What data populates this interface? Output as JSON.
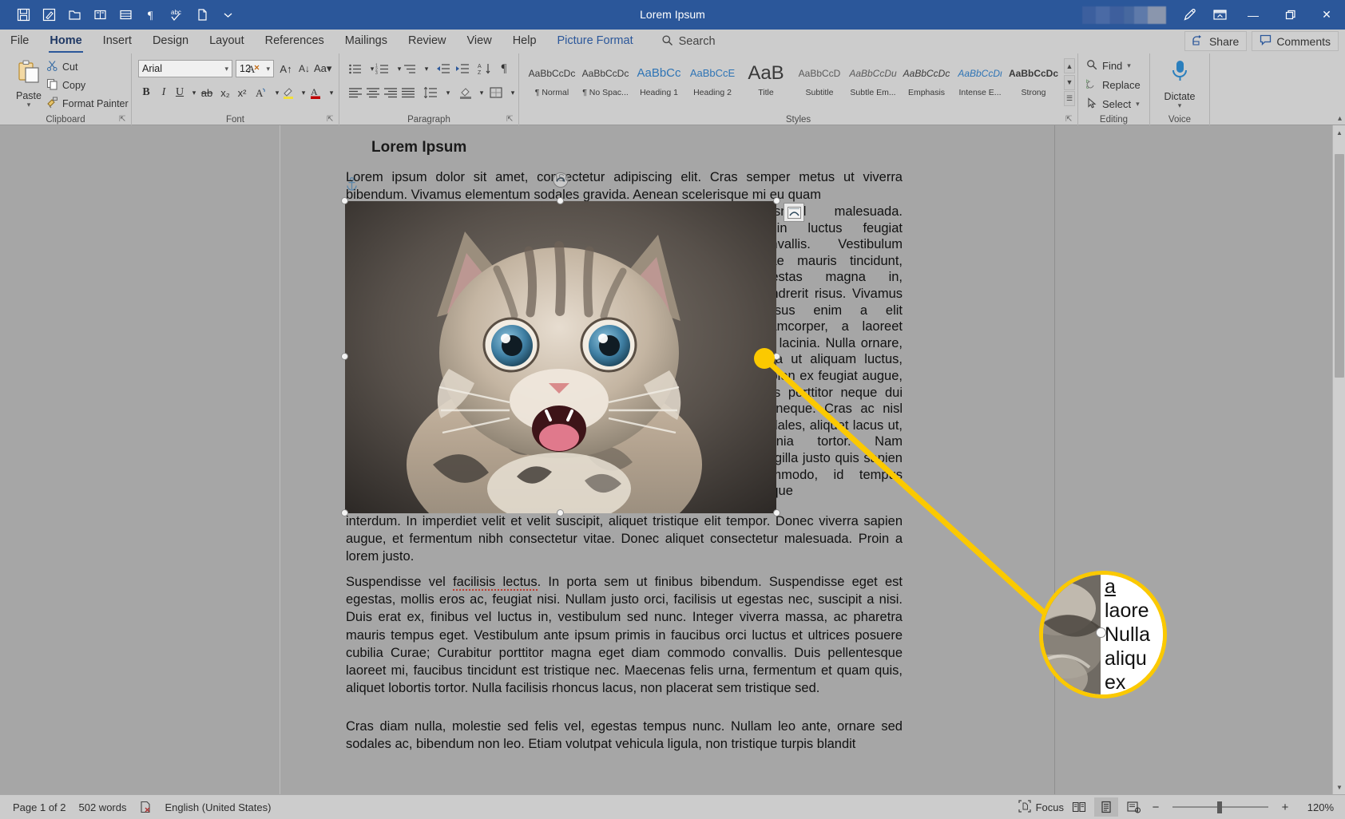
{
  "window": {
    "title": "Lorem Ipsum",
    "quick_access": [
      {
        "name": "save-icon",
        "label": "Save"
      },
      {
        "name": "autosave-icon",
        "label": "AutoSave"
      },
      {
        "name": "open-icon",
        "label": "Open"
      },
      {
        "name": "print-preview-icon",
        "label": "Print Preview and Print"
      },
      {
        "name": "table-icon",
        "label": "Draw Table"
      },
      {
        "name": "pilcrow-icon",
        "label": "Show/Hide Formatting Marks"
      },
      {
        "name": "spelling-icon",
        "label": "Spelling & Grammar"
      },
      {
        "name": "new-doc-icon",
        "label": "New"
      },
      {
        "name": "chevron-down-icon",
        "label": "Customize Quick Access Toolbar"
      }
    ],
    "right_icons": [
      {
        "name": "pen-icon",
        "label": "Draw"
      },
      {
        "name": "ribbon-display-icon",
        "label": "Ribbon Display Options"
      }
    ],
    "controls": {
      "minimize": "—",
      "restore": "❐",
      "close": "✕"
    }
  },
  "tabs": [
    {
      "label": "File",
      "active": false
    },
    {
      "label": "Home",
      "active": true
    },
    {
      "label": "Insert",
      "active": false
    },
    {
      "label": "Design",
      "active": false
    },
    {
      "label": "Layout",
      "active": false
    },
    {
      "label": "References",
      "active": false
    },
    {
      "label": "Mailings",
      "active": false
    },
    {
      "label": "Review",
      "active": false
    },
    {
      "label": "View",
      "active": false
    },
    {
      "label": "Help",
      "active": false
    },
    {
      "label": "Picture Format",
      "active": false,
      "contextual": true
    }
  ],
  "search": {
    "placeholder": "Search",
    "label": "Search",
    "icon": "search-icon"
  },
  "header_actions": [
    {
      "label": "Share",
      "icon": "share-icon"
    },
    {
      "label": "Comments",
      "icon": "comment-icon"
    }
  ],
  "ribbon": {
    "groups": [
      {
        "label": "Clipboard"
      },
      {
        "label": "Font"
      },
      {
        "label": "Paragraph"
      },
      {
        "label": "Styles"
      },
      {
        "label": "Editing"
      },
      {
        "label": "Voice"
      }
    ],
    "clipboard": {
      "paste_label": "Paste",
      "items": [
        {
          "label": "Cut",
          "icon": "scissors-icon"
        },
        {
          "label": "Copy",
          "icon": "copy-icon"
        },
        {
          "label": "Format Painter",
          "icon": "format-painter-icon"
        }
      ]
    },
    "font": {
      "font_name": "Arial",
      "font_size": "12",
      "buttons": [
        {
          "name": "grow-font-icon",
          "glyph": "A↑"
        },
        {
          "name": "shrink-font-icon",
          "glyph": "A↓"
        },
        {
          "name": "change-case-icon",
          "glyph": "Aa"
        },
        {
          "name": "clear-formatting-icon",
          "glyph": "A⃠"
        },
        {
          "name": "bold-icon",
          "glyph": "B"
        },
        {
          "name": "italic-icon",
          "glyph": "I"
        },
        {
          "name": "underline-icon",
          "glyph": "U"
        },
        {
          "name": "strikethrough-icon",
          "glyph": "ab"
        },
        {
          "name": "subscript-icon",
          "glyph": "x₂"
        },
        {
          "name": "superscript-icon",
          "glyph": "x²"
        },
        {
          "name": "text-effects-icon",
          "glyph": "A"
        },
        {
          "name": "text-highlight-icon",
          "glyph": "✐"
        },
        {
          "name": "font-color-icon",
          "glyph": "A"
        }
      ]
    },
    "paragraph": {
      "buttons": [
        {
          "name": "bullets-icon"
        },
        {
          "name": "numbering-icon"
        },
        {
          "name": "multilevel-list-icon"
        },
        {
          "name": "decrease-indent-icon"
        },
        {
          "name": "increase-indent-icon"
        },
        {
          "name": "sort-icon"
        },
        {
          "name": "show-formatting-marks-icon"
        },
        {
          "name": "align-left-icon"
        },
        {
          "name": "align-center-icon"
        },
        {
          "name": "align-right-icon"
        },
        {
          "name": "justify-icon"
        },
        {
          "name": "line-spacing-icon"
        },
        {
          "name": "shading-icon"
        },
        {
          "name": "borders-icon"
        }
      ]
    },
    "styles": [
      {
        "preview": "AaBbCcDc",
        "name": "¶ Normal"
      },
      {
        "preview": "AaBbCcDc",
        "name": "¶ No Spac..."
      },
      {
        "preview": "AaBbCc",
        "name": "Heading 1"
      },
      {
        "preview": "AaBbCcE",
        "name": "Heading 2"
      },
      {
        "preview": "AaB",
        "name": "Title"
      },
      {
        "preview": "AaBbCcD",
        "name": "Subtitle"
      },
      {
        "preview": "AaBbCcDu",
        "name": "Subtle Em..."
      },
      {
        "preview": "AaBbCcDc",
        "name": "Emphasis"
      },
      {
        "preview": "AaBbCcDι",
        "name": "Intense E..."
      },
      {
        "preview": "AaBbCcDc",
        "name": "Strong"
      }
    ],
    "editing": [
      {
        "label": "Find",
        "icon": "search-icon",
        "has_caret": true
      },
      {
        "label": "Replace",
        "icon": "replace-icon",
        "has_caret": false
      },
      {
        "label": "Select",
        "icon": "select-icon",
        "has_caret": true
      }
    ],
    "voice": {
      "label": "Dictate",
      "icon": "microphone-icon"
    }
  },
  "document": {
    "heading": "Lorem Ipsum",
    "paragraph_1_left": "Lorem ipsum dolor sit amet, consectetur adipiscing elit. Cras semper metus ut viverra bibendum. Vivamus elementum sodales gravida. Aenean scelerisque mi eu quam",
    "paragraph_1_right_col": "euismod malesuada. Proin luctus feugiat convallis. Vestibulum vitae mauris tincidunt, egestas magna in, hendrerit risus. Vivamus cursus enim a elit ullamcorper, a laoreet leo lacinia. Nulla ornare, urna ut aliquam luctus, sapien ex feugiat augue, quis porttitor neque dui at neque. Cras ac nisl sodales, aliquet lacus ut, lacinia tortor. Nam fringilla justo quis sapien commodo, id tempus neque",
    "paragraph_1_tail": "interdum. In imperdiet velit et velit suscipit, aliquet tristique elit tempor. Donec viverra sapien augue, et fermentum nibh consectetur vitae. Donec aliquet consectetur malesuada. Proin a lorem justo.",
    "paragraph_2_pre": "Suspendisse vel ",
    "paragraph_2_spell": "facilisis lectus",
    "paragraph_2_post": ". In porta sem ut finibus bibendum. Suspendisse eget est egestas, mollis eros ac, feugiat nisi. Nullam justo orci, facilisis ut egestas nec, suscipit a nisi. Duis erat ex, finibus vel luctus in, vestibulum sed nunc. Integer viverra massa, ac pharetra mauris tempus eget. Vestibulum ante ipsum primis in faucibus orci luctus et ultrices posuere cubilia Curae; Curabitur porttitor magna eget diam commodo convallis. Duis pellentesque laoreet mi, faucibus tincidunt est tristique nec. Maecenas felis urna, fermentum et quam quis, aliquet lobortis tortor. Nulla facilisis rhoncus lacus, non placerat sem tristique sed.",
    "paragraph_3": "Cras diam nulla, molestie sed felis vel, egestas tempus nunc. Nullam leo ante, ornare sed sodales ac, bibendum non leo. Etiam volutpat vehicula ligula, non tristique turpis blandit"
  },
  "image_selection": {
    "layout_options_icon": "layout-options-icon",
    "rotate_handle_icon": "rotate-icon",
    "anchor_icon": "anchor-icon",
    "handles": 8
  },
  "callout": {
    "color": "#fbc900",
    "magnified_lines": [
      "a",
      "laore",
      "Nulla",
      "aliqu",
      "ex"
    ]
  },
  "statusbar": {
    "page": "Page 1 of 2",
    "words": "502 words",
    "proofing_icon": "proofing-errors-icon",
    "language": "English (United States)",
    "focus": "Focus",
    "views": [
      {
        "name": "read-mode-icon",
        "active": false
      },
      {
        "name": "print-layout-icon",
        "active": true
      },
      {
        "name": "web-layout-icon",
        "active": false
      }
    ],
    "zoom_out": "−",
    "zoom_in": "+",
    "zoom_level": "120%"
  }
}
